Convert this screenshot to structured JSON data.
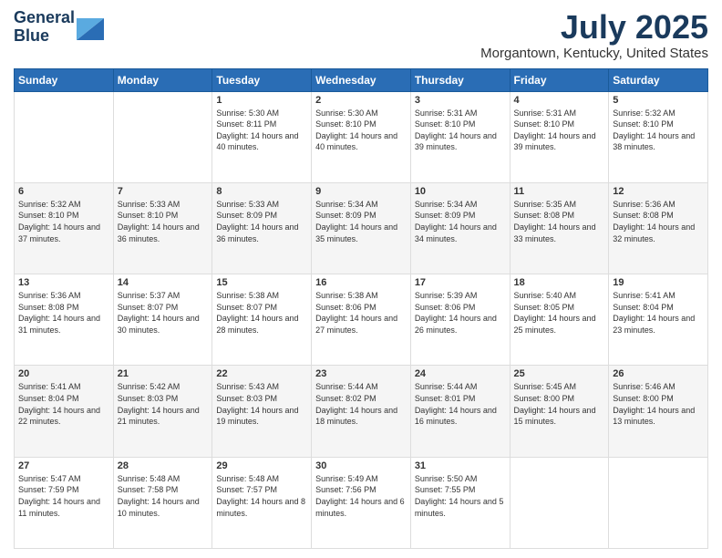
{
  "header": {
    "logo_line1": "General",
    "logo_line2": "Blue",
    "title": "July 2025",
    "subtitle": "Morgantown, Kentucky, United States"
  },
  "weekdays": [
    "Sunday",
    "Monday",
    "Tuesday",
    "Wednesday",
    "Thursday",
    "Friday",
    "Saturday"
  ],
  "weeks": [
    [
      {
        "day": "",
        "info": ""
      },
      {
        "day": "",
        "info": ""
      },
      {
        "day": "1",
        "info": "Sunrise: 5:30 AM\nSunset: 8:11 PM\nDaylight: 14 hours and 40 minutes."
      },
      {
        "day": "2",
        "info": "Sunrise: 5:30 AM\nSunset: 8:10 PM\nDaylight: 14 hours and 40 minutes."
      },
      {
        "day": "3",
        "info": "Sunrise: 5:31 AM\nSunset: 8:10 PM\nDaylight: 14 hours and 39 minutes."
      },
      {
        "day": "4",
        "info": "Sunrise: 5:31 AM\nSunset: 8:10 PM\nDaylight: 14 hours and 39 minutes."
      },
      {
        "day": "5",
        "info": "Sunrise: 5:32 AM\nSunset: 8:10 PM\nDaylight: 14 hours and 38 minutes."
      }
    ],
    [
      {
        "day": "6",
        "info": "Sunrise: 5:32 AM\nSunset: 8:10 PM\nDaylight: 14 hours and 37 minutes."
      },
      {
        "day": "7",
        "info": "Sunrise: 5:33 AM\nSunset: 8:10 PM\nDaylight: 14 hours and 36 minutes."
      },
      {
        "day": "8",
        "info": "Sunrise: 5:33 AM\nSunset: 8:09 PM\nDaylight: 14 hours and 36 minutes."
      },
      {
        "day": "9",
        "info": "Sunrise: 5:34 AM\nSunset: 8:09 PM\nDaylight: 14 hours and 35 minutes."
      },
      {
        "day": "10",
        "info": "Sunrise: 5:34 AM\nSunset: 8:09 PM\nDaylight: 14 hours and 34 minutes."
      },
      {
        "day": "11",
        "info": "Sunrise: 5:35 AM\nSunset: 8:08 PM\nDaylight: 14 hours and 33 minutes."
      },
      {
        "day": "12",
        "info": "Sunrise: 5:36 AM\nSunset: 8:08 PM\nDaylight: 14 hours and 32 minutes."
      }
    ],
    [
      {
        "day": "13",
        "info": "Sunrise: 5:36 AM\nSunset: 8:08 PM\nDaylight: 14 hours and 31 minutes."
      },
      {
        "day": "14",
        "info": "Sunrise: 5:37 AM\nSunset: 8:07 PM\nDaylight: 14 hours and 30 minutes."
      },
      {
        "day": "15",
        "info": "Sunrise: 5:38 AM\nSunset: 8:07 PM\nDaylight: 14 hours and 28 minutes."
      },
      {
        "day": "16",
        "info": "Sunrise: 5:38 AM\nSunset: 8:06 PM\nDaylight: 14 hours and 27 minutes."
      },
      {
        "day": "17",
        "info": "Sunrise: 5:39 AM\nSunset: 8:06 PM\nDaylight: 14 hours and 26 minutes."
      },
      {
        "day": "18",
        "info": "Sunrise: 5:40 AM\nSunset: 8:05 PM\nDaylight: 14 hours and 25 minutes."
      },
      {
        "day": "19",
        "info": "Sunrise: 5:41 AM\nSunset: 8:04 PM\nDaylight: 14 hours and 23 minutes."
      }
    ],
    [
      {
        "day": "20",
        "info": "Sunrise: 5:41 AM\nSunset: 8:04 PM\nDaylight: 14 hours and 22 minutes."
      },
      {
        "day": "21",
        "info": "Sunrise: 5:42 AM\nSunset: 8:03 PM\nDaylight: 14 hours and 21 minutes."
      },
      {
        "day": "22",
        "info": "Sunrise: 5:43 AM\nSunset: 8:03 PM\nDaylight: 14 hours and 19 minutes."
      },
      {
        "day": "23",
        "info": "Sunrise: 5:44 AM\nSunset: 8:02 PM\nDaylight: 14 hours and 18 minutes."
      },
      {
        "day": "24",
        "info": "Sunrise: 5:44 AM\nSunset: 8:01 PM\nDaylight: 14 hours and 16 minutes."
      },
      {
        "day": "25",
        "info": "Sunrise: 5:45 AM\nSunset: 8:00 PM\nDaylight: 14 hours and 15 minutes."
      },
      {
        "day": "26",
        "info": "Sunrise: 5:46 AM\nSunset: 8:00 PM\nDaylight: 14 hours and 13 minutes."
      }
    ],
    [
      {
        "day": "27",
        "info": "Sunrise: 5:47 AM\nSunset: 7:59 PM\nDaylight: 14 hours and 11 minutes."
      },
      {
        "day": "28",
        "info": "Sunrise: 5:48 AM\nSunset: 7:58 PM\nDaylight: 14 hours and 10 minutes."
      },
      {
        "day": "29",
        "info": "Sunrise: 5:48 AM\nSunset: 7:57 PM\nDaylight: 14 hours and 8 minutes."
      },
      {
        "day": "30",
        "info": "Sunrise: 5:49 AM\nSunset: 7:56 PM\nDaylight: 14 hours and 6 minutes."
      },
      {
        "day": "31",
        "info": "Sunrise: 5:50 AM\nSunset: 7:55 PM\nDaylight: 14 hours and 5 minutes."
      },
      {
        "day": "",
        "info": ""
      },
      {
        "day": "",
        "info": ""
      }
    ]
  ]
}
